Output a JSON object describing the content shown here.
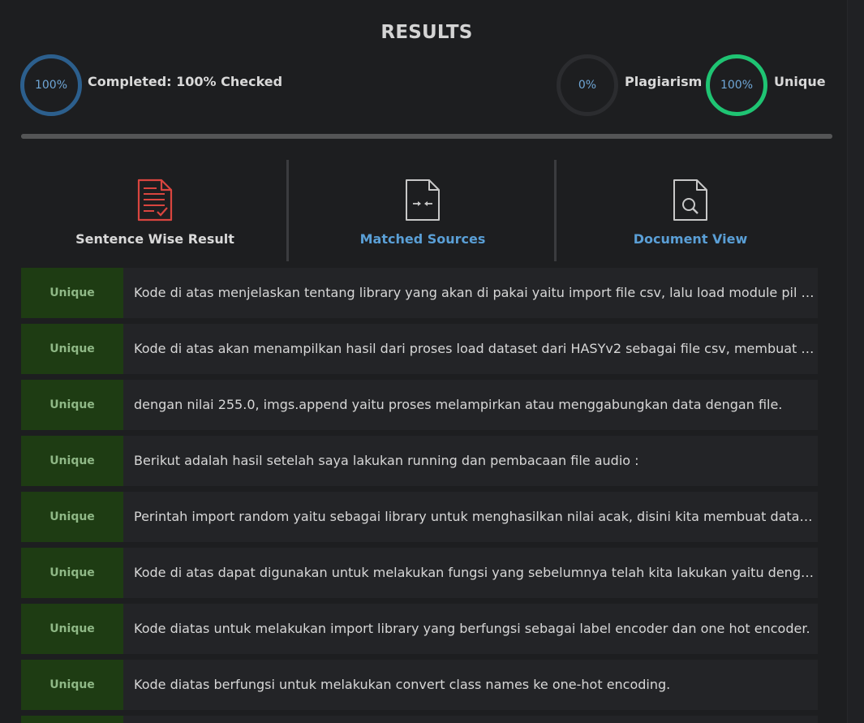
{
  "header": {
    "title": "RESULTS"
  },
  "stats": {
    "completed": {
      "percent": "100%",
      "label": "Completed: 100% Checked"
    },
    "plagiarism": {
      "percent": "0%",
      "label": "Plagiarism"
    },
    "unique": {
      "percent": "100%",
      "label": "Unique"
    }
  },
  "progress": {
    "fraction": 1.0
  },
  "tabs": [
    {
      "label": "Sentence Wise Result",
      "icon": "sentence-result-icon",
      "active": true
    },
    {
      "label": "Matched Sources",
      "icon": "matched-sources-icon",
      "active": false
    },
    {
      "label": "Document View",
      "icon": "document-view-icon",
      "active": false
    }
  ],
  "results": [
    {
      "status": "Unique",
      "text": "Kode di atas menjelaskan tentang library yang akan di pakai yaitu import file csv, lalu load module pil image"
    },
    {
      "status": "Unique",
      "text": "Kode di atas akan menampilkan hasil dari proses load dataset dari HASYv2 sebagai file csv, membuat array"
    },
    {
      "status": "Unique",
      "text": "dengan nilai 255.0, imgs.append yaitu proses melampirkan atau menggabungkan data dengan file."
    },
    {
      "status": "Unique",
      "text": "Berikut adalah hasil setelah saya lakukan running dan pembacaan file audio :"
    },
    {
      "status": "Unique",
      "text": "Perintah import random yaitu sebagai library untuk menghasilkan nilai acak, disini kita membuat data acak"
    },
    {
      "status": "Unique",
      "text": "Kode di atas dapat digunakan untuk melakukan fungsi yang sebelumnya telah kita lakukan yaitu dengan model"
    },
    {
      "status": "Unique",
      "text": "Kode diatas untuk melakukan import library yang berfungsi sebagai label encoder dan one hot encoder."
    },
    {
      "status": "Unique",
      "text": "Kode diatas berfungsi untuk melakukan convert class names ke one-hot encoding."
    }
  ],
  "colors": {
    "background": "#1d1e20",
    "unique_badge": "#1e3c13",
    "unique_ring": "#1fc473",
    "completed_ring": "#2c5f8d",
    "link": "#5a9fd6",
    "sentence_icon": "#d9453f"
  }
}
